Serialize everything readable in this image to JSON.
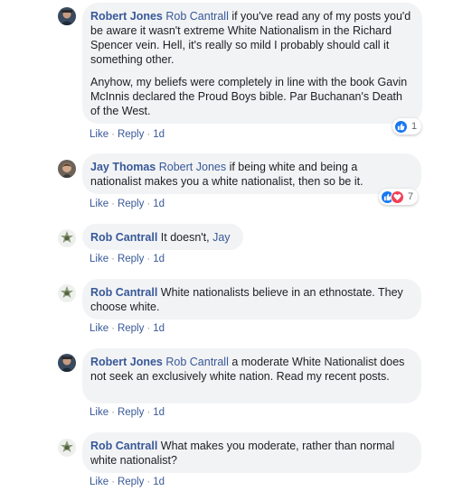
{
  "comments": [
    {
      "author": "Robert Jones",
      "paragraphs": [
        {
          "mention": "Rob Cantrall",
          "text": " if you've read any of my posts you'd be aware it wasn't extreme White Nationalism in the Richard Spencer vein. Hell, it's really so mild I probably should call it something other."
        },
        {
          "mention": "",
          "text": "Anyhow, my beliefs were completely in line with the book Gavin McInnis declared the Proud Boys bible. Par Buchanan's Death of the West."
        }
      ],
      "like": "Like",
      "reply": "Reply",
      "time": "1d",
      "reaction_count": "1"
    },
    {
      "author": "Jay Thomas",
      "paragraphs": [
        {
          "mention": "Robert Jones",
          "text": " if being white and being a nationalist makes you a white nationalist, then so be it."
        }
      ],
      "like": "Like",
      "reply": "Reply",
      "time": "1d",
      "reaction_count": "7"
    },
    {
      "author": "Rob Cantrall",
      "paragraphs": [
        {
          "text": "It doesn't, ",
          "mention_after": "Jay"
        }
      ],
      "like": "Like",
      "reply": "Reply",
      "time": "1d"
    },
    {
      "author": "Rob Cantrall",
      "paragraphs": [
        {
          "text": "White nationalists believe in an ethnostate. They choose white."
        }
      ],
      "like": "Like",
      "reply": "Reply",
      "time": "1d"
    },
    {
      "author": "Robert Jones",
      "paragraphs": [
        {
          "mention": "Rob Cantrall",
          "text": " a moderate White Nationalist does not seek an exclusively white nation. Read my recent posts."
        }
      ],
      "like": "Like",
      "reply": "Reply",
      "time": "1d"
    },
    {
      "author": "Rob Cantrall",
      "paragraphs": [
        {
          "text": "What makes you moderate, rather than normal white nationalist?"
        }
      ],
      "like": "Like",
      "reply": "Reply",
      "time": "1d"
    }
  ],
  "icons": {
    "like": "thumbs-up-icon",
    "love": "heart-icon"
  },
  "colors": {
    "link": "#385898",
    "bubble": "#f2f3f5",
    "like_blue": "#1877f2",
    "love_red": "#f33e58"
  }
}
